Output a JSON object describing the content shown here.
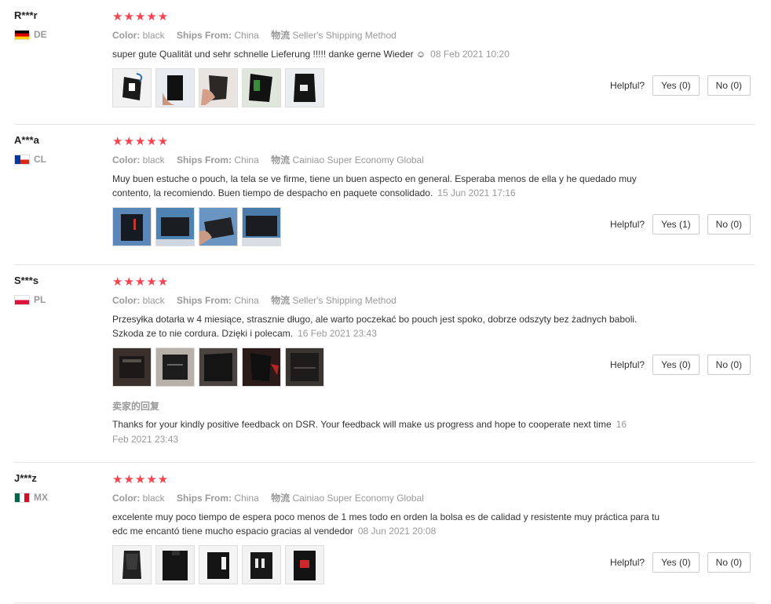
{
  "reviews": [
    {
      "user": "R***r",
      "country": "DE",
      "stars": "★★★★★",
      "color_label": "Color:",
      "color": "black",
      "ships_label": "Ships From:",
      "ships": "China",
      "logistics_label": "物流",
      "logistics": "Seller's Shipping Method",
      "text": "super gute Qualität und sehr schnelle Lieferung !!!!! danke gerne Wieder ☺",
      "date": "08 Feb 2021 10:20",
      "helpful_label": "Helpful?",
      "yes": "Yes (0)",
      "no": "No (0)"
    },
    {
      "user": "A***a",
      "country": "CL",
      "stars": "★★★★★",
      "color_label": "Color:",
      "color": "black",
      "ships_label": "Ships From:",
      "ships": "China",
      "logistics_label": "物流",
      "logistics": "Cainiao Super Economy Global",
      "text": "Muy buen estuche o pouch, la tela se ve firme, tiene un buen aspecto en general. Esperaba menos de ella y he quedado muy contento, la recomiendo. Buen tiempo de despacho en paquete consolidado.",
      "date": "15 Jun 2021 17:16",
      "helpful_label": "Helpful?",
      "yes": "Yes (1)",
      "no": "No (0)"
    },
    {
      "user": "S***s",
      "country": "PL",
      "stars": "★★★★★",
      "color_label": "Color:",
      "color": "black",
      "ships_label": "Ships From:",
      "ships": "China",
      "logistics_label": "物流",
      "logistics": "Seller's Shipping Method",
      "text": "Przesyłka dotarła w 4 miesiące, strasznie długo, ale warto poczekać bo pouch jest spoko, dobrze odszyty bez żadnych baboli. Szkoda ze to nie cordura. Dzięki i polecam.",
      "date": "16 Feb 2021 23:43",
      "helpful_label": "Helpful?",
      "yes": "Yes (0)",
      "no": "No (0)",
      "reply_title": "卖家的回复",
      "reply_text": "Thanks for your kindly positive feedback on DSR. Your feedback will make us progress and hope to cooperate next time",
      "reply_date": "16 Feb 2021 23:43"
    },
    {
      "user": "J***z",
      "country": "MX",
      "stars": "★★★★★",
      "color_label": "Color:",
      "color": "black",
      "ships_label": "Ships From:",
      "ships": "China",
      "logistics_label": "物流",
      "logistics": "Cainiao Super Economy Global",
      "text": "excelente muy poco tiempo de espera poco menos de 1 mes todo en orden la bolsa es de calidad y resistente muy práctica para tu edc me encantó tiene mucho espacio gracias al vendedor",
      "date": "08 Jun 2021 20:08",
      "helpful_label": "Helpful?",
      "yes": "Yes (0)",
      "no": "No (0)"
    }
  ],
  "colors": {
    "star": "#f5434f",
    "muted": "#999999",
    "text": "#333333",
    "divider": "#e6e6e6"
  }
}
